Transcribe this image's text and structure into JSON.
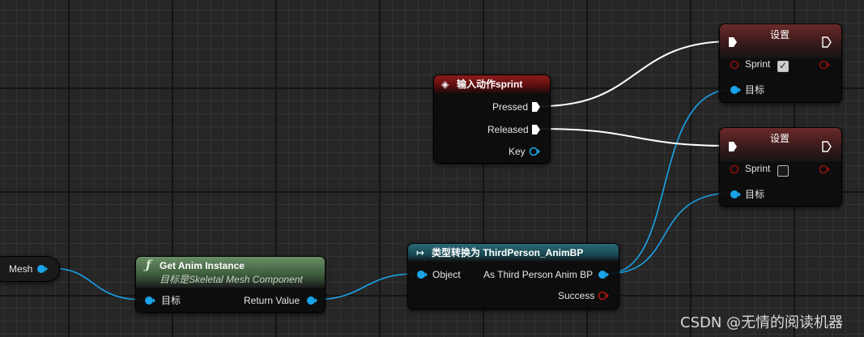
{
  "nodes": {
    "mesh": {
      "label": "Mesh"
    },
    "get_anim": {
      "title": "Get Anim Instance",
      "subtitle": "目标是Skeletal Mesh Component",
      "target_label": "目标",
      "return_label": "Return Value"
    },
    "cast": {
      "title": "类型转换为 ThirdPerson_AnimBP",
      "object_label": "Object",
      "as_label": "As Third Person Anim BP",
      "success_label": "Success"
    },
    "input": {
      "title": "输入动作sprint",
      "pressed_label": "Pressed",
      "released_label": "Released",
      "key_label": "Key"
    },
    "set1": {
      "title": "设置",
      "sprint_label": "Sprint",
      "sprint_checked": true,
      "target_label": "目标"
    },
    "set2": {
      "title": "设置",
      "sprint_label": "Sprint",
      "sprint_checked": false,
      "target_label": "目标"
    }
  },
  "watermark": "CSDN @无情的阅读机器",
  "colors": {
    "object_pin": "#1aa3e8",
    "bool_pin": "#8a0f0f",
    "exec": "#ffffff"
  }
}
